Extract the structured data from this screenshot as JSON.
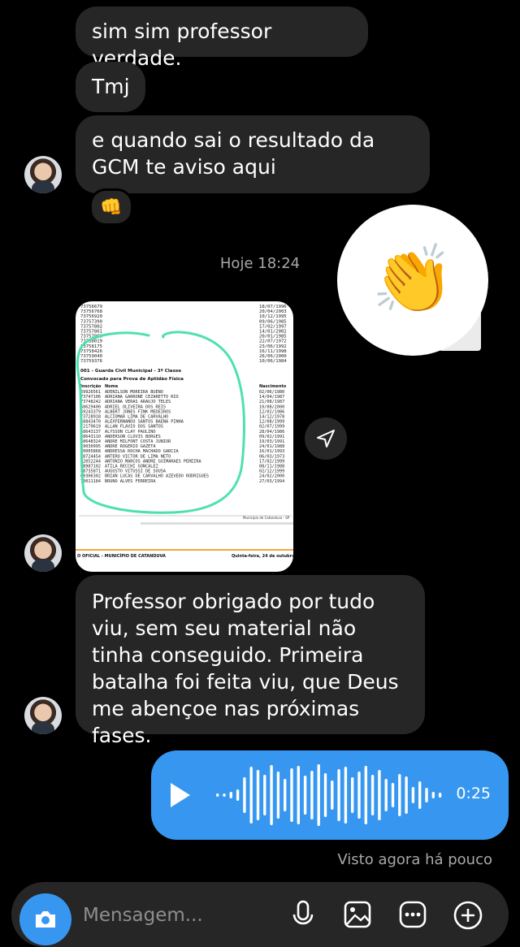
{
  "messages": {
    "m1": "sim sim professor verdade.",
    "m2": "Tmj",
    "m3": "e quando sai o resultado da GCM te aviso aqui",
    "m3_reaction": "👊",
    "timestamp": "Hoje 18:24",
    "clap_emoji": "👏",
    "m4": "Professor obrigado por tudo viu, sem seu material não tinha conseguido. Primeira batalha foi feita viu, que Deus me abençoe nas próximas fases."
  },
  "photo": {
    "section_title": "001 - Guarda Civil Municipal - 3ª Classe",
    "subtitle": "Convocado para Prova de Aptidão Física",
    "col_inscricao": "Inscrição",
    "col_nome": "Nome",
    "col_nascimento": "Nascimento",
    "footer_municipio": "Município de Catanduva - SP",
    "footer_left": "O OFICIAL - MUNICÍPIO DE CATANDUVA",
    "footer_right": "Quinta-feira, 24 de outubro de",
    "rows": [
      [
        "69926561",
        "ADENILSON MOREIRA BUENO",
        "02/06/1980"
      ],
      [
        "73747106",
        "ADRIANA GARRONE CEZARETTO RIO",
        "14/04/1987"
      ],
      [
        "73748242",
        "ADRIANA VERAS ARAUJO TELES",
        "21/08/1987"
      ],
      [
        "68629400",
        "ADRIEL OLIVEIRA DOS REIS",
        "10/08/2000"
      ],
      [
        "69243379",
        "ALBERT JONES FINK MEDEIROS",
        "12/02/1986"
      ],
      [
        "73728918",
        "ALCIOMAR LIMA DE CARVALHO",
        "14/12/1978"
      ],
      [
        "68843470",
        "ALEXFERNANDO SANTOS BAENA PINHA",
        "12/08/1999"
      ],
      [
        "72179619",
        "ALLAN FLAVIO DOS SANTOS",
        "02/07/1999"
      ],
      [
        "68643137",
        "ALYSSON CLAY PAULINO",
        "28/04/1986"
      ],
      [
        "68643110",
        "ANDERSON CLOVIS BORGES",
        "09/02/1991"
      ],
      [
        "68648324",
        "ANDRE MILFONT COSTA JUNIOR",
        "19/03/1991"
      ],
      [
        "69030995",
        "ANDRE ROGERIO GAZETA",
        "24/01/1988"
      ],
      [
        "70005868",
        "ANDRESSA ROCHA MACHADO GARCIA",
        "16/01/1993"
      ],
      [
        "68724454",
        "ANTERO VICTOR DE LIMA NETO",
        "06/03/1973"
      ],
      [
        "72052244",
        "ANTONIO MARCOS ANDRE GUIMARAES PEREIRA",
        "17/02/1999"
      ],
      [
        "68987102",
        "ATILA RECCHI GONCALEZ",
        "08/11/1988"
      ],
      [
        "68735871",
        "AUGUSTO VITUSSI DE SOUSA",
        "02/12/1999"
      ],
      [
        "69306302",
        "BRIAN LUCAS DE CARVALHO AZEVEDO RODRIGUES",
        "24/02/2000"
      ],
      [
        "70011184",
        "BRUNO ALVES FERREIRA",
        "27/03/1994"
      ]
    ],
    "top_rows": [
      [
        "73756679",
        "18/07/1996"
      ],
      [
        "73756768",
        "20/04/2003"
      ],
      [
        "73756920",
        "10/12/1995"
      ],
      [
        "73757390",
        "09/06/1985"
      ],
      [
        "73757802",
        "17/02/1997"
      ],
      [
        "73757861",
        "14/01/2002"
      ],
      [
        "73757969",
        "20/01/1985"
      ],
      [
        "73758019",
        "22/07/1972"
      ],
      [
        "73758175",
        "23/06/1992"
      ],
      [
        "73758426",
        "16/11/1998"
      ],
      [
        "73759040",
        "26/06/2000"
      ],
      [
        "73759376",
        "10/06/1984"
      ]
    ]
  },
  "voice": {
    "duration": "0:25",
    "progress": 0.0
  },
  "status": {
    "seen": "Visto agora há pouco"
  },
  "composer": {
    "placeholder": "Mensagem..."
  },
  "colors": {
    "bubble_in": "#262626",
    "bubble_out": "#3797f0",
    "highlight": "#4fe0b0"
  }
}
